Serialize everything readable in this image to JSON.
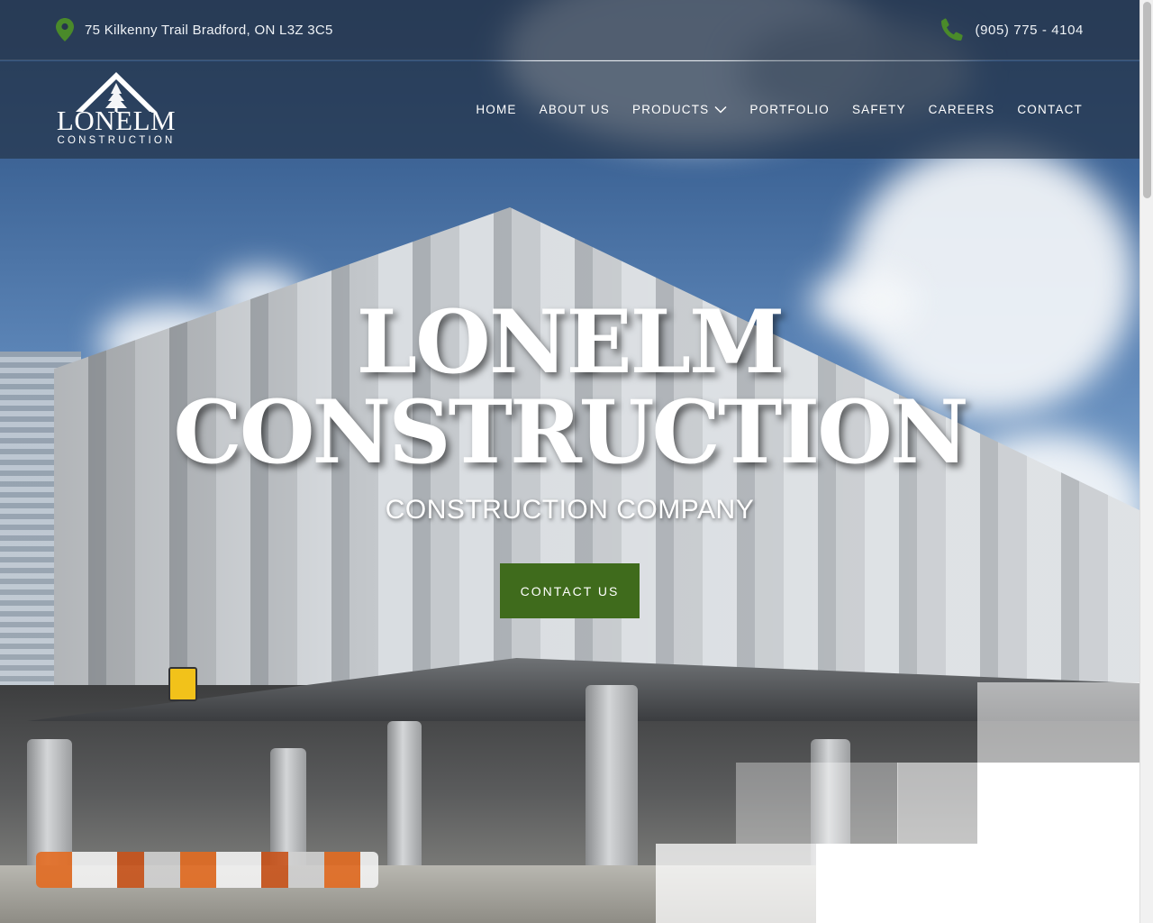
{
  "topbar": {
    "address": "75 Kilkenny Trail Bradford, ON L3Z 3C5",
    "phone": "(905) 775 - 4104",
    "icons": {
      "address": "map-pin-icon",
      "phone": "phone-icon"
    },
    "icon_color": "#4a8a2a"
  },
  "logo": {
    "name": "LONELM",
    "subtitle": "CONSTRUCTION"
  },
  "nav": {
    "items": [
      {
        "label": "HOME"
      },
      {
        "label": "ABOUT US"
      },
      {
        "label": "PRODUCTS",
        "has_dropdown": true
      },
      {
        "label": "PORTFOLIO"
      },
      {
        "label": "SAFETY"
      },
      {
        "label": "CAREERS"
      },
      {
        "label": "CONTACT"
      }
    ]
  },
  "hero": {
    "title_line1": "LONELM",
    "title_line2": "CONSTRUCTION",
    "subtitle": "CONSTRUCTION COMPANY",
    "cta_label": "CONTACT US",
    "cta_color": "#3f6b1c"
  }
}
